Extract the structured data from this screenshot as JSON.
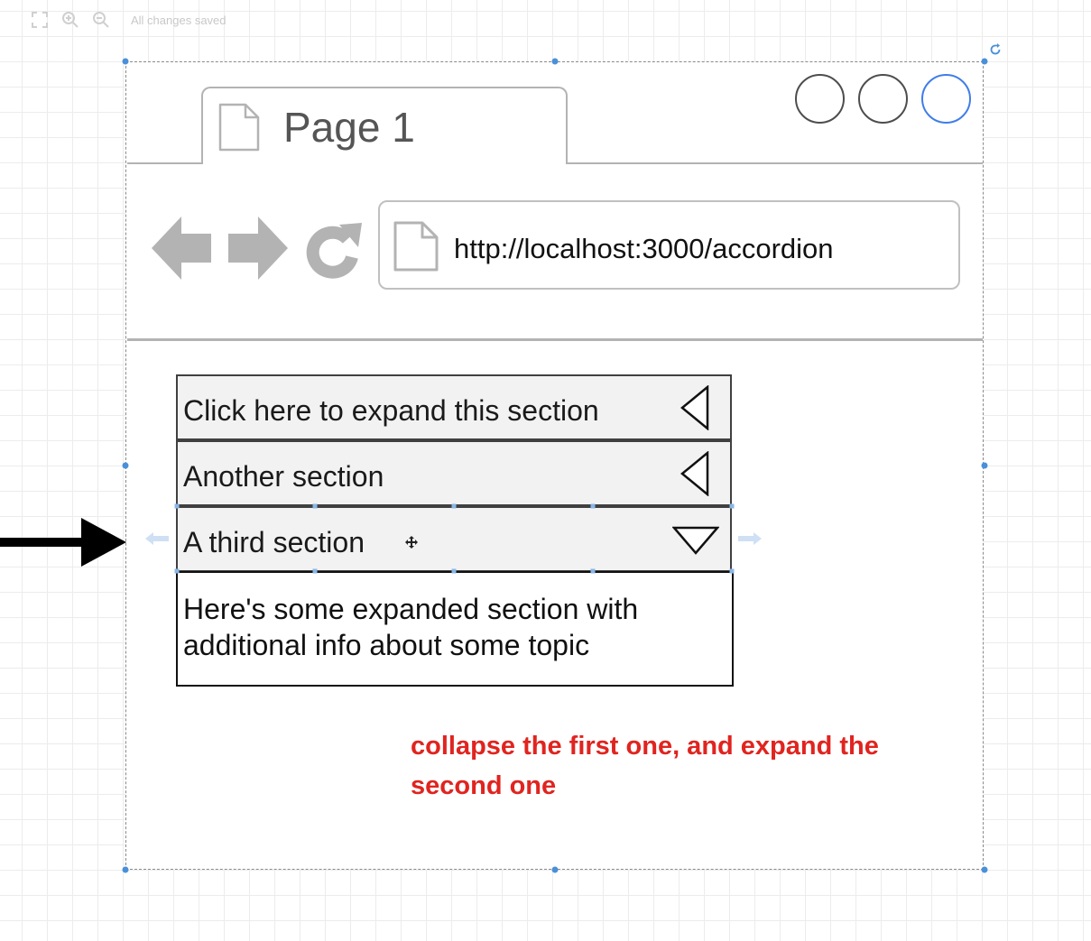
{
  "editor": {
    "status": "All changes saved",
    "icons": [
      "fullscreen-icon",
      "zoom-in-icon",
      "zoom-out-icon"
    ]
  },
  "browser": {
    "tab_title": "Page 1",
    "url": "http://localhost:3000/accordion",
    "window_buttons": [
      "minimize-button",
      "maximize-button",
      "close-button"
    ],
    "nav_icons": [
      "back-arrow-icon",
      "forward-arrow-icon",
      "reload-icon"
    ]
  },
  "accordion": {
    "sections": [
      {
        "label": "Click here to expand this section",
        "state": "collapsed"
      },
      {
        "label": "Another section",
        "state": "collapsed"
      },
      {
        "label": "A third section",
        "state": "expanded"
      }
    ],
    "expanded_text": "Here's some expanded section with additional info about some topic"
  },
  "annotation": {
    "note": "collapse the first one, and expand the second one",
    "color": "#e0241f"
  },
  "colors": {
    "selection_handle": "#4a90d9",
    "accordion_header_bg": "#f2f2f2"
  }
}
